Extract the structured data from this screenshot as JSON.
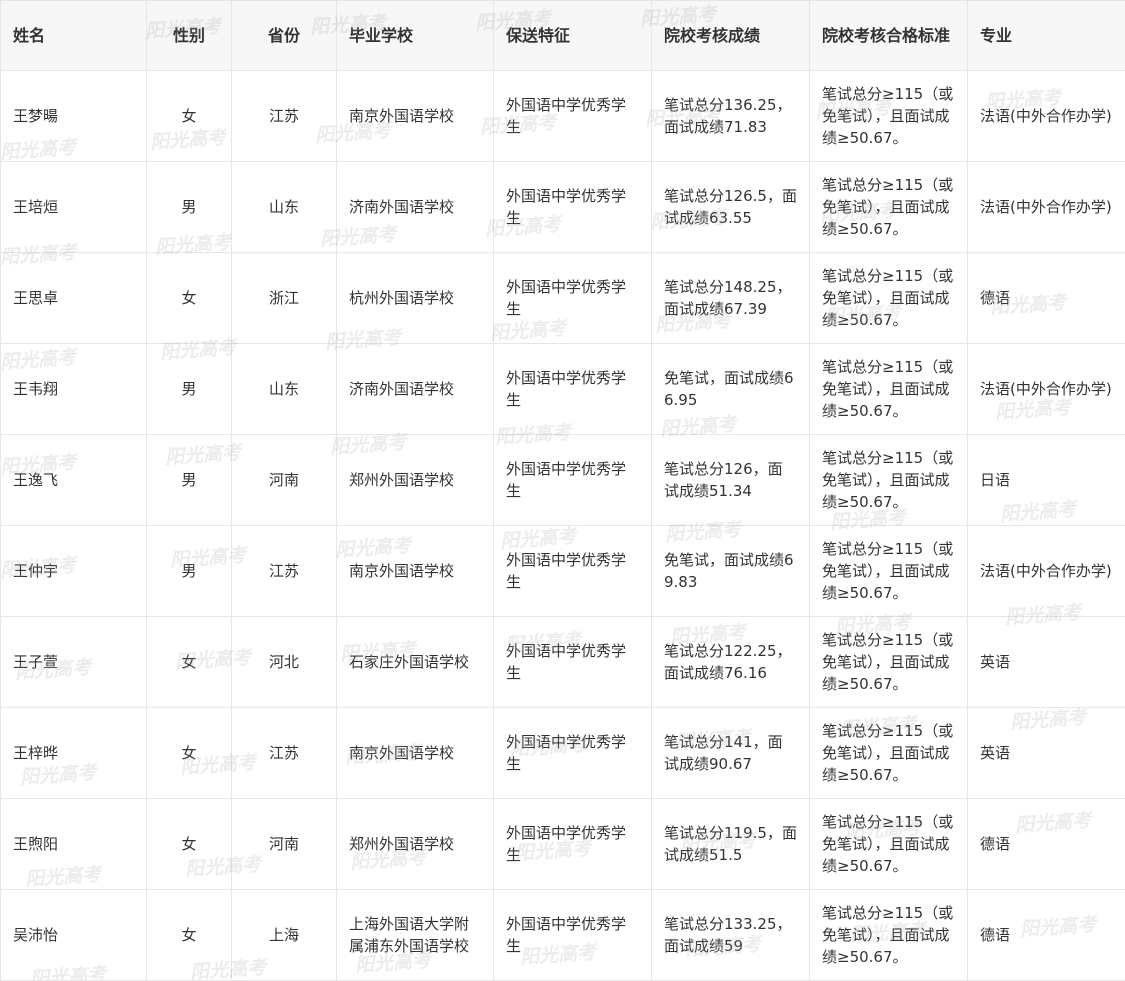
{
  "table": {
    "headers": [
      "姓名",
      "性别",
      "省份",
      "毕业学校",
      "保送特征",
      "院校考核成绩",
      "院校考核合格标准",
      "专业"
    ],
    "rows": [
      {
        "name": "王梦暘",
        "gender": "女",
        "province": "江苏",
        "school": "南京外国语学校",
        "feature": "外国语中学优秀学生",
        "score": "笔试总分136.25，面试成绩71.83",
        "standard": "笔试总分≥115（或免笔试），且面试成绩≥50.67。",
        "major": "法语(中外合作办学)"
      },
      {
        "name": "王培烜",
        "gender": "男",
        "province": "山东",
        "school": "济南外国语学校",
        "feature": "外国语中学优秀学生",
        "score": "笔试总分126.5，面试成绩63.55",
        "standard": "笔试总分≥115（或免笔试），且面试成绩≥50.67。",
        "major": "法语(中外合作办学)"
      },
      {
        "name": "王思卓",
        "gender": "女",
        "province": "浙江",
        "school": "杭州外国语学校",
        "feature": "外国语中学优秀学生",
        "score": "笔试总分148.25，面试成绩67.39",
        "standard": "笔试总分≥115（或免笔试），且面试成绩≥50.67。",
        "major": "德语"
      },
      {
        "name": "王韦翔",
        "gender": "男",
        "province": "山东",
        "school": "济南外国语学校",
        "feature": "外国语中学优秀学生",
        "score": "免笔试，面试成绩66.95",
        "standard": "笔试总分≥115（或免笔试），且面试成绩≥50.67。",
        "major": "法语(中外合作办学)"
      },
      {
        "name": "王逸飞",
        "gender": "男",
        "province": "河南",
        "school": "郑州外国语学校",
        "feature": "外国语中学优秀学生",
        "score": "笔试总分126，面试成绩51.34",
        "standard": "笔试总分≥115（或免笔试），且面试成绩≥50.67。",
        "major": "日语"
      },
      {
        "name": "王仲宇",
        "gender": "男",
        "province": "江苏",
        "school": "南京外国语学校",
        "feature": "外国语中学优秀学生",
        "score": "免笔试，面试成绩69.83",
        "standard": "笔试总分≥115（或免笔试），且面试成绩≥50.67。",
        "major": "法语(中外合作办学)"
      },
      {
        "name": "王子萱",
        "gender": "女",
        "province": "河北",
        "school": "石家庄外国语学校",
        "feature": "外国语中学优秀学生",
        "score": "笔试总分122.25，面试成绩76.16",
        "standard": "笔试总分≥115（或免笔试），且面试成绩≥50.67。",
        "major": "英语"
      },
      {
        "name": "王梓晔",
        "gender": "女",
        "province": "江苏",
        "school": "南京外国语学校",
        "feature": "外国语中学优秀学生",
        "score": "笔试总分141，面试成绩90.67",
        "standard": "笔试总分≥115（或免笔试），且面试成绩≥50.67。",
        "major": "英语"
      },
      {
        "name": "王煦阳",
        "gender": "女",
        "province": "河南",
        "school": "郑州外国语学校",
        "feature": "外国语中学优秀学生",
        "score": "笔试总分119.5，面试成绩51.5",
        "standard": "笔试总分≥115（或免笔试），且面试成绩≥50.67。",
        "major": "德语"
      },
      {
        "name": "吴沛怡",
        "gender": "女",
        "province": "上海",
        "school": "上海外国语大学附属浦东外国语学校",
        "feature": "外国语中学优秀学生",
        "score": "笔试总分133.25，面试成绩59",
        "standard": "笔试总分≥115（或免笔试），且面试成绩≥50.67。",
        "major": "德语"
      }
    ]
  },
  "watermark": {
    "text": "阳光高考"
  },
  "colors": {
    "header_bg": "#f7f7f7",
    "border": "#e6e6e6",
    "text": "#333333"
  }
}
